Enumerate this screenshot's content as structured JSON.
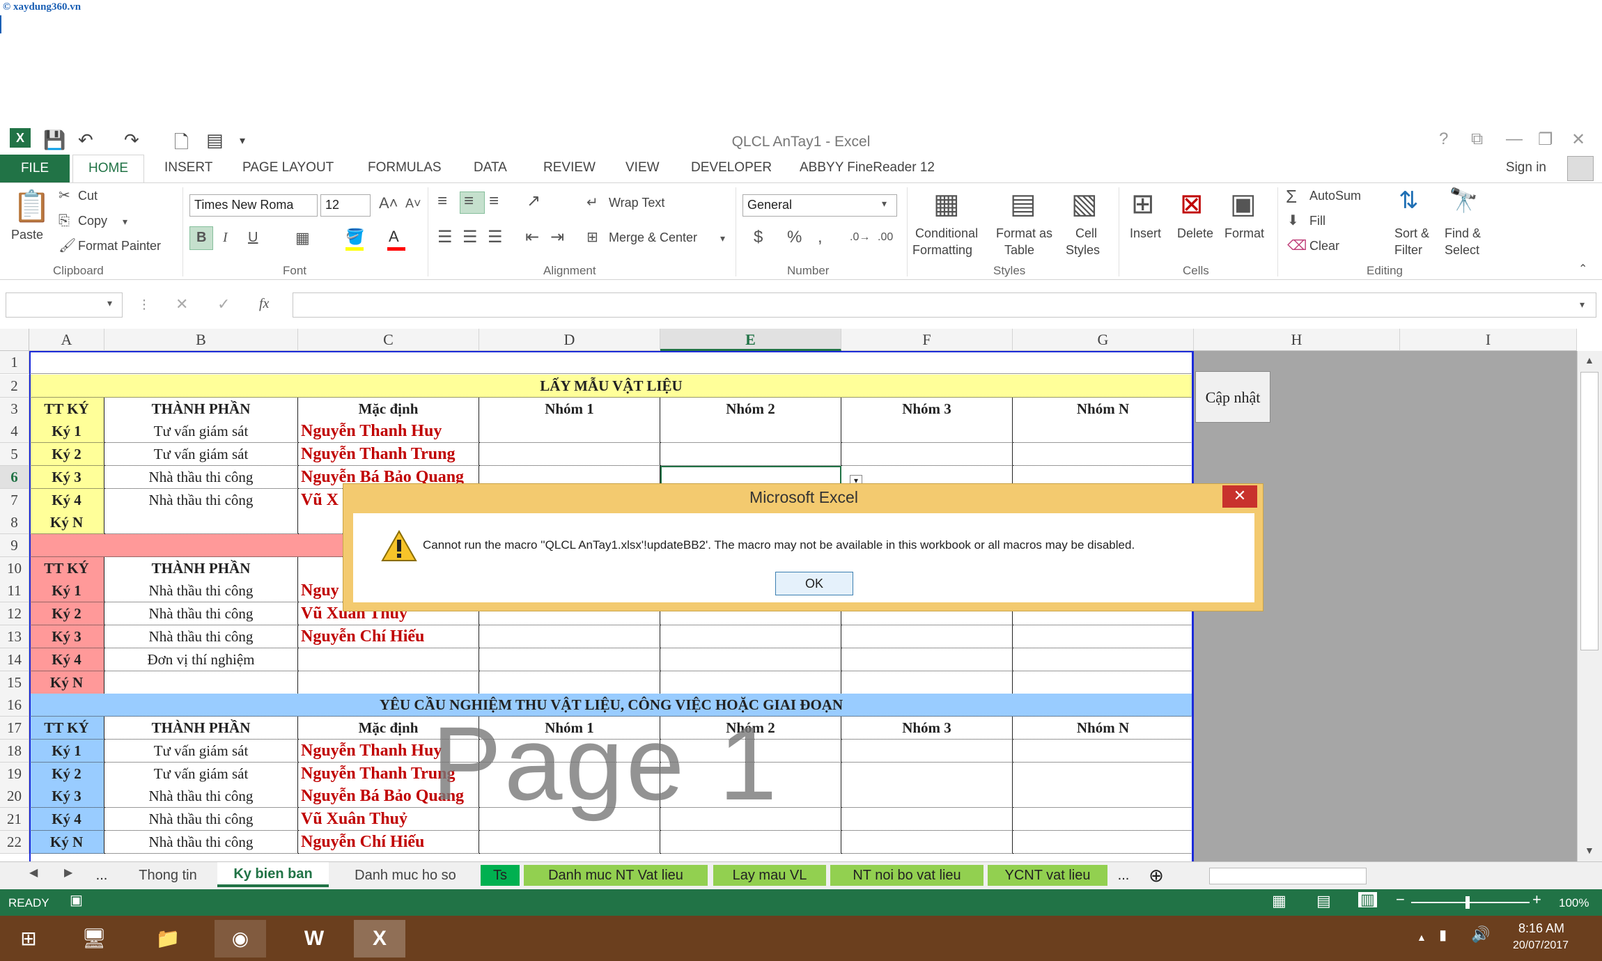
{
  "watermark": "© xaydung360.vn",
  "window": {
    "title": "QLCL AnTay1 - Excel",
    "help": "?",
    "restore": "⧉",
    "minimize": "—",
    "maximize": "❐",
    "close": "✕"
  },
  "tabs": {
    "file": "FILE",
    "items": [
      "HOME",
      "INSERT",
      "PAGE LAYOUT",
      "FORMULAS",
      "DATA",
      "REVIEW",
      "VIEW",
      "DEVELOPER",
      "ABBYY FineReader 12"
    ],
    "signin": "Sign in"
  },
  "ribbon": {
    "paste": "Paste",
    "cut": "Cut",
    "copy": "Copy",
    "format_painter": "Format Painter",
    "clipboard": "Clipboard",
    "font_name": "Times New Roma",
    "font_size": "12",
    "font": "Font",
    "wrap_text": "Wrap Text",
    "merge_center": "Merge & Center",
    "alignment": "Alignment",
    "number_format": "General",
    "number": "Number",
    "cond_format": [
      "Conditional",
      "Formatting"
    ],
    "format_table": [
      "Format as",
      "Table"
    ],
    "cell_styles": [
      "Cell",
      "Styles"
    ],
    "styles": "Styles",
    "insert": "Insert",
    "delete": "Delete",
    "format": "Format",
    "cells": "Cells",
    "autosum": "AutoSum",
    "fill": "Fill",
    "clear": "Clear",
    "sort": [
      "Sort &",
      "Filter"
    ],
    "find": [
      "Find &",
      "Select"
    ],
    "editing": "Editing"
  },
  "formula": {
    "fx": "fx"
  },
  "columns": [
    "A",
    "B",
    "C",
    "D",
    "E",
    "F",
    "G",
    "H",
    "I"
  ],
  "rows": [
    "1",
    "2",
    "3",
    "4",
    "5",
    "6",
    "7",
    "8",
    "9",
    "10",
    "11",
    "12",
    "13",
    "14",
    "15",
    "16",
    "17",
    "18",
    "19",
    "20",
    "21",
    "22"
  ],
  "sheet": {
    "title1": "LẤY MẪU VẬT LIỆU",
    "title3": "YÊU CẦU NGHIỆM THU VẬT LIỆU, CÔNG VIỆC HOẶC GIAI ĐOẠN",
    "header": {
      "tt": "TT KÝ",
      "tp": "THÀNH PHẦN",
      "md": "Mặc định",
      "n1": "Nhóm 1",
      "n2": "Nhóm 2",
      "n3": "Nhóm 3",
      "nn": "Nhóm N"
    },
    "s1": [
      {
        "ky": "Ký 1",
        "tp": "Tư vấn giám sát",
        "name": "Nguyễn Thanh Huy"
      },
      {
        "ky": "Ký 2",
        "tp": "Tư vấn giám sát",
        "name": "Nguyễn Thanh Trung"
      },
      {
        "ky": "Ký 3",
        "tp": "Nhà thầu thi công",
        "name": "Nguyễn Bá Bảo Quang"
      },
      {
        "ky": "Ký 4",
        "tp": "Nhà thầu thi công",
        "name": "Vũ X"
      },
      {
        "ky": "Ký N",
        "tp": "",
        "name": ""
      }
    ],
    "s2": [
      {
        "ky": "Ký 1",
        "tp": "Nhà thầu thi công",
        "name": "Nguy"
      },
      {
        "ky": "Ký 2",
        "tp": "Nhà thầu thi công",
        "name": "Vũ Xuân Thuỷ"
      },
      {
        "ky": "Ký 3",
        "tp": "Nhà thầu thi công",
        "name": "Nguyễn Chí Hiếu"
      },
      {
        "ky": "Ký 4",
        "tp": "Đơn vị thí nghiệm",
        "name": ""
      },
      {
        "ky": "Ký N",
        "tp": "",
        "name": ""
      }
    ],
    "s3": [
      {
        "ky": "Ký 1",
        "tp": "Tư vấn giám sát",
        "name": "Nguyễn Thanh Huy"
      },
      {
        "ky": "Ký 2",
        "tp": "Tư vấn giám sát",
        "name": "Nguyễn Thanh Trung"
      },
      {
        "ky": "Ký 3",
        "tp": "Nhà thầu thi công",
        "name": "Nguyễn Bá Bảo Quang"
      },
      {
        "ky": "Ký 4",
        "tp": "Nhà thầu thi công",
        "name": "Vũ Xuân Thuỷ"
      },
      {
        "ky": "Ký N",
        "tp": "Nhà thầu thi công",
        "name": "Nguyễn Chí Hiếu"
      }
    ],
    "button": "Cập nhật",
    "page_watermark": "Page 1"
  },
  "dialog": {
    "title": "Microsoft Excel",
    "message": "Cannot run the macro ''QLCL AnTay1.xlsx'!updateBB2'. The macro may not be available in this workbook or all macros may be disabled.",
    "ok": "OK",
    "close": "✕"
  },
  "sheet_tabs": {
    "dots": "...",
    "items": [
      "Thong tin",
      "Ky bien ban",
      "Danh muc ho so",
      "Ts",
      "Danh muc NT Vat lieu",
      "Lay mau VL",
      "NT noi bo vat lieu",
      "YCNT vat lieu"
    ],
    "more": "...",
    "add": "⊕"
  },
  "status": {
    "ready": "READY",
    "zoom": "100%"
  },
  "taskbar": {
    "time": "8:16 AM",
    "date": "20/07/2017"
  },
  "colors": {
    "excel_green": "#217346",
    "yellow": "#ffff99",
    "red": "#ff9999",
    "blue": "#99ccff",
    "name_red": "#c00000",
    "dialog": "#f3ca6f"
  }
}
